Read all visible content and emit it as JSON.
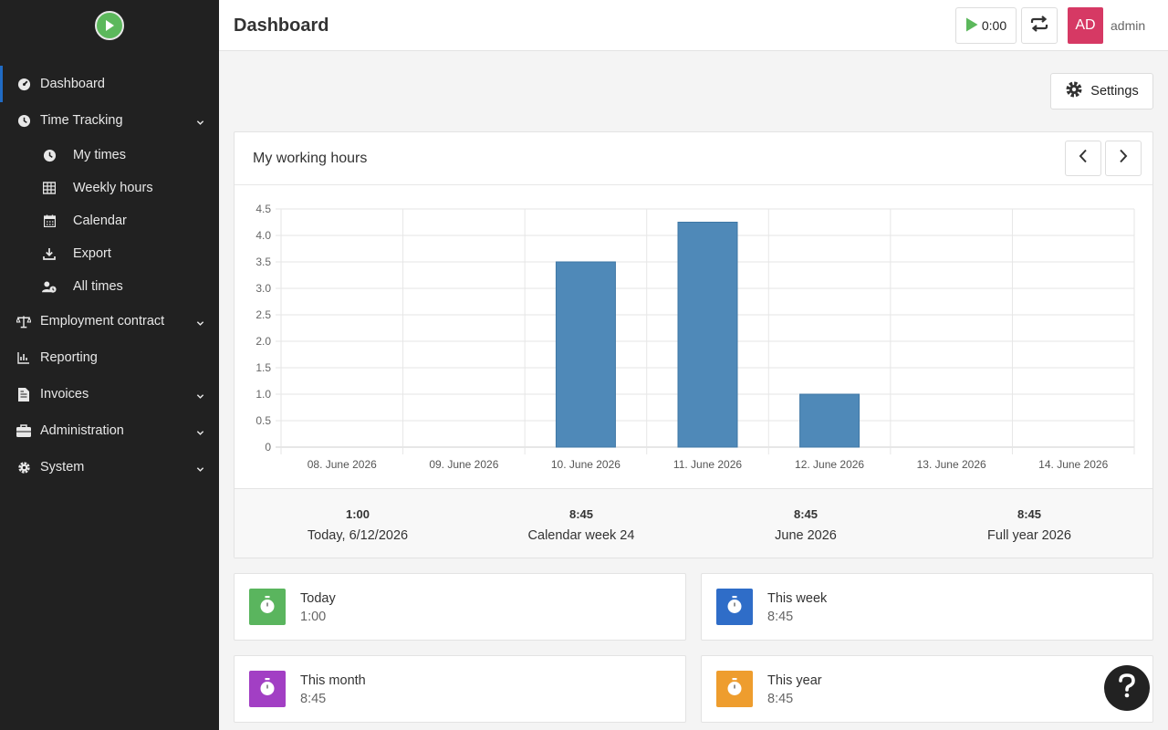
{
  "app": {
    "logo_icon": "play-circle-icon"
  },
  "sidebar": {
    "items": [
      {
        "label": "Dashboard",
        "icon": "gauge-icon"
      },
      {
        "label": "Time Tracking",
        "icon": "clock-icon"
      },
      {
        "label": "My times",
        "icon": "clock-icon"
      },
      {
        "label": "Weekly hours",
        "icon": "table-icon"
      },
      {
        "label": "Calendar",
        "icon": "calendar-icon"
      },
      {
        "label": "Export",
        "icon": "download-icon"
      },
      {
        "label": "All times",
        "icon": "user-clock-icon"
      },
      {
        "label": "Employment contract",
        "icon": "scale-icon"
      },
      {
        "label": "Reporting",
        "icon": "chart-icon"
      },
      {
        "label": "Invoices",
        "icon": "invoice-icon"
      },
      {
        "label": "Administration",
        "icon": "briefcase-icon"
      },
      {
        "label": "System",
        "icon": "gear-icon"
      }
    ]
  },
  "header": {
    "title": "Dashboard",
    "timer": "0:00",
    "avatar_initials": "AD",
    "username": "admin"
  },
  "toolbar": {
    "settings_label": "Settings"
  },
  "working_hours": {
    "title": "My working hours",
    "stats": [
      {
        "value": "1:00",
        "label": "Today, 6/12/2026"
      },
      {
        "value": "8:45",
        "label": "Calendar week 24"
      },
      {
        "value": "8:45",
        "label": "June 2026"
      },
      {
        "value": "8:45",
        "label": "Full year 2026"
      }
    ]
  },
  "chart_data": {
    "type": "bar",
    "categories": [
      "08. June 2026",
      "09. June 2026",
      "10. June 2026",
      "11. June 2026",
      "12. June 2026",
      "13. June 2026",
      "14. June 2026"
    ],
    "values": [
      0,
      0,
      3.5,
      4.25,
      1.0,
      0,
      0
    ],
    "yticks": [
      "0",
      "0.5",
      "1.0",
      "1.5",
      "2.0",
      "2.5",
      "3.0",
      "3.5",
      "4.0",
      "4.5"
    ],
    "ylim": [
      0,
      4.5
    ],
    "grid": true,
    "bar_color": "#4f89b8"
  },
  "summary_cards": [
    {
      "title": "Today",
      "value": "1:00",
      "color": "#5ab55e"
    },
    {
      "title": "This week",
      "value": "8:45",
      "color": "#2f6dc8"
    },
    {
      "title": "This month",
      "value": "8:45",
      "color": "#a23fc4"
    },
    {
      "title": "This year",
      "value": "8:45",
      "color": "#ee9d2e"
    }
  ]
}
